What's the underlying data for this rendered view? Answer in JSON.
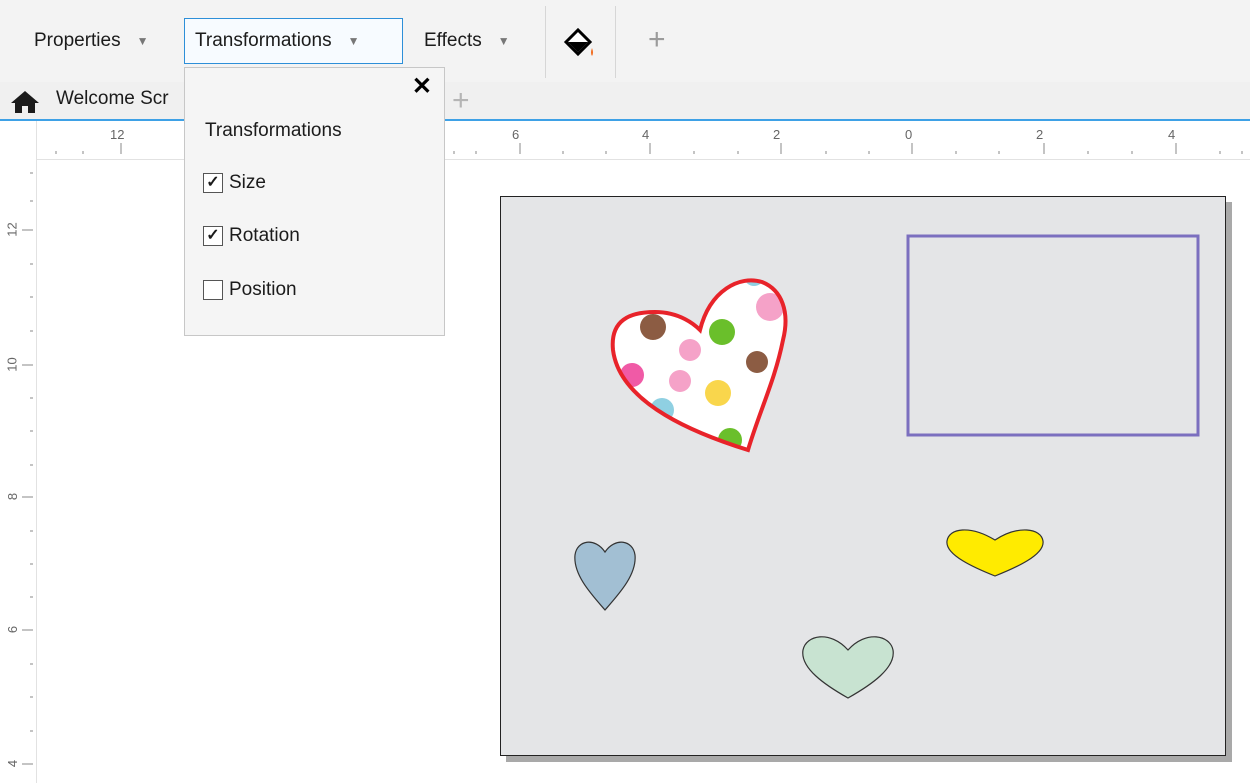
{
  "toolbar": {
    "properties_label": "Properties",
    "transformations_label": "Transformations",
    "effects_label": "Effects",
    "paint_icon": "paint-bucket-icon",
    "add_label": "+"
  },
  "tabs": {
    "home_icon": "home-icon",
    "welcome_label": "Welcome Scr",
    "add_label": "+"
  },
  "popup": {
    "close_label": "✕",
    "title": "Transformations",
    "options": [
      {
        "label": "Size",
        "checked": true,
        "mark": "✓"
      },
      {
        "label": "Rotation",
        "checked": true,
        "mark": "✓"
      },
      {
        "label": "Position",
        "checked": false,
        "mark": ""
      }
    ]
  },
  "ruler": {
    "horizontal": [
      "12",
      "6",
      "4",
      "2",
      "0",
      "2",
      "4"
    ],
    "vertical": [
      "12",
      "10",
      "8",
      "6",
      "4"
    ]
  },
  "colors": {
    "accent": "#3ea1e6",
    "heart_outline": "#e8232a",
    "rectangle_outline": "#7b6fbf",
    "heart_blue": "#a2bfd3",
    "heart_yellow": "#ffeb00",
    "heart_green": "#c8e3d1"
  }
}
